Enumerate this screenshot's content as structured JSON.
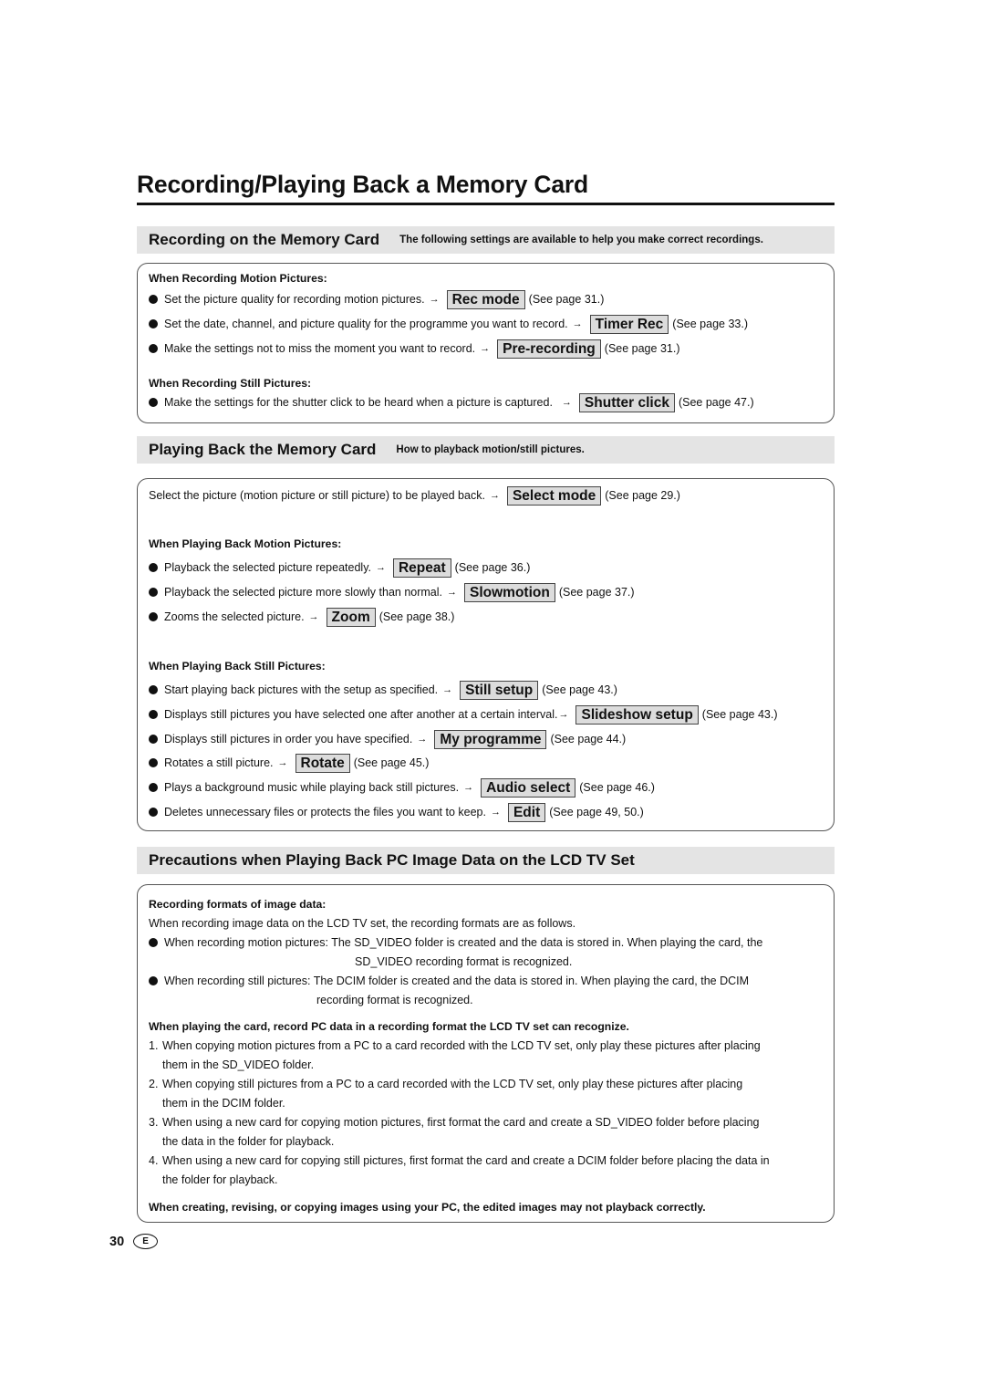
{
  "title": "Recording/Playing Back a Memory Card",
  "recording": {
    "heading": "Recording on the Memory Card",
    "subheading": "The following settings are available to help you make correct recordings.",
    "motion_head": "When Recording Motion Pictures:",
    "motion_items": [
      {
        "text": "Set the picture quality for recording motion pictures.",
        "key": "Rec mode",
        "see": "(See page 31.)"
      },
      {
        "text": "Set the date, channel, and picture quality for the programme you want to record.",
        "key": "Timer Rec",
        "see": "(See page 33.)"
      },
      {
        "text": "Make the settings not to miss the moment you want to record.",
        "key": "Pre-recording",
        "see": "(See page 31.)"
      }
    ],
    "still_head": "When Recording Still Pictures:",
    "still_items": [
      {
        "text": "Make the settings for the shutter click to be heard when a picture is captured.",
        "key": "Shutter click",
        "see": "(See page 47.)"
      }
    ]
  },
  "playback": {
    "heading": "Playing Back the Memory Card",
    "subheading": "How to playback motion/still pictures.",
    "select": {
      "text": "Select the picture (motion picture or still picture) to be played back.",
      "key": "Select mode",
      "see": "(See page 29.)"
    },
    "motion_head": "When Playing Back Motion Pictures:",
    "motion_items": [
      {
        "text": "Playback the selected picture repeatedly.",
        "key": "Repeat",
        "see": "(See page 36.)"
      },
      {
        "text": "Playback the selected picture more slowly than normal.",
        "key": "Slowmotion",
        "see": "(See page 37.)"
      },
      {
        "text": "Zooms the selected picture.",
        "key": "Zoom",
        "see": "(See page 38.)"
      }
    ],
    "still_head": "When Playing Back Still Pictures:",
    "still_items": [
      {
        "text": "Start playing back pictures with the setup as specified.",
        "key": "Still setup",
        "see": "(See page 43.)"
      },
      {
        "text": "Displays still pictures you have selected one after another at a certain interval.",
        "key": "Slideshow setup",
        "see": "(See page 43.)"
      },
      {
        "text": "Displays still pictures in order you have specified.",
        "key": "My programme",
        "see": "(See page 44.)"
      },
      {
        "text": "Rotates a still picture.",
        "key": "Rotate",
        "see": "(See page 45.)"
      },
      {
        "text": "Plays a background music while playing back still pictures.",
        "key": "Audio select",
        "see": "(See page 46.)"
      },
      {
        "text": "Deletes unnecessary files or protects the files you want to keep.",
        "key": "Edit",
        "see": "(See page 49, 50.)"
      }
    ]
  },
  "precautions": {
    "heading": "Precautions when Playing Back PC Image Data on the LCD TV Set",
    "formats_head": "Recording formats of image data:",
    "formats_intro": "When recording image data on the LCD TV set, the recording formats are as follows.",
    "formats_items": [
      {
        "line1": "When recording motion pictures: The SD_VIDEO folder is created and the data is stored in. When playing the card, the",
        "line2": "SD_VIDEO recording format is recognized."
      },
      {
        "line1": "When recording still pictures: The DCIM folder is created and the data is stored in. When playing the card, the DCIM",
        "line2": "recording format is recognized."
      }
    ],
    "pc_head": "When playing the card, record PC data in a recording format the LCD TV set can recognize.",
    "pc_items": [
      {
        "num": "1.",
        "line1": "When copying motion pictures from a PC to a card recorded with the LCD TV set, only play these pictures after placing",
        "line2": "them in the SD_VIDEO folder."
      },
      {
        "num": "2.",
        "line1": "When copying still pictures from a PC to a card recorded with the LCD TV set, only play these pictures after placing",
        "line2": "them in the DCIM folder."
      },
      {
        "num": "3.",
        "line1": "When using a new card for copying motion pictures, first format the card and create a SD_VIDEO folder before placing",
        "line2": "the data in the folder for playback."
      },
      {
        "num": "4.",
        "line1": "When using a new card for copying still pictures, first format the card and create a DCIM folder before placing the data in",
        "line2": "the folder for playback."
      }
    ],
    "final_note": "When creating, revising, or copying images using your PC, the edited images may not playback correctly."
  },
  "footer": {
    "page_number": "30",
    "language_badge": "E"
  },
  "icons": {
    "bullet": "filled-circle",
    "arrow": "→"
  }
}
